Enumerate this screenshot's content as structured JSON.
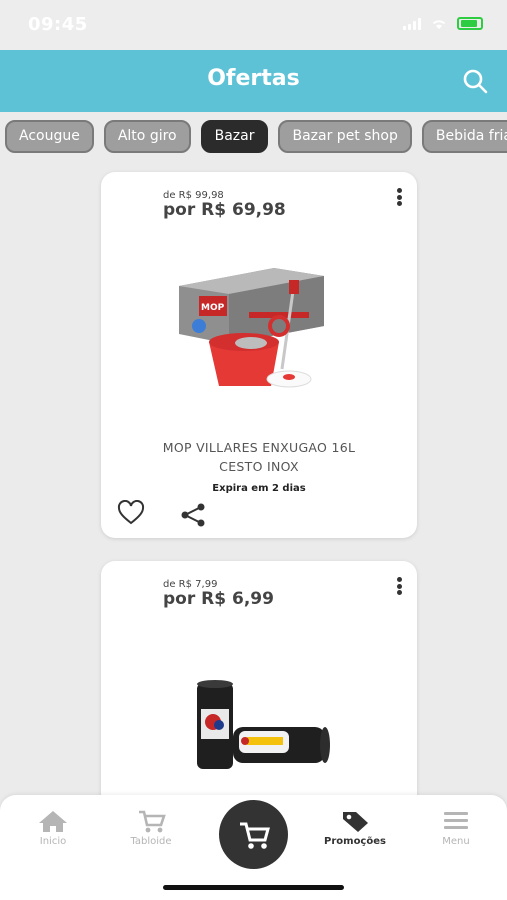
{
  "status_bar": {
    "time": "09:45"
  },
  "header": {
    "title": "Ofertas"
  },
  "categories": [
    {
      "label": "Acougue",
      "active": false
    },
    {
      "label": "Alto giro",
      "active": false
    },
    {
      "label": "Bazar",
      "active": true
    },
    {
      "label": "Bazar pet shop",
      "active": false
    },
    {
      "label": "Bebida fria",
      "active": false
    }
  ],
  "offers": [
    {
      "old_price": "de R$ 99,98",
      "new_price": "por R$ 69,98",
      "name_line1": "MOP VILLARES ENXUGAO 16L",
      "name_line2": "CESTO INOX",
      "expires": "Expira em 2 dias"
    },
    {
      "old_price": "de R$ 7,99",
      "new_price": "por R$ 6,99"
    }
  ],
  "bottom_nav": [
    {
      "label": "Inicio",
      "icon": "home-icon"
    },
    {
      "label": "Tabloide",
      "icon": "cart-icon"
    },
    {
      "label": "Promoções",
      "icon": "tag-icon"
    },
    {
      "label": "Menu",
      "icon": "menu-icon"
    }
  ],
  "colors": {
    "accent": "#5ec2d7",
    "chip_active": "#2b2b2b",
    "chip": "#9e9e9e"
  }
}
